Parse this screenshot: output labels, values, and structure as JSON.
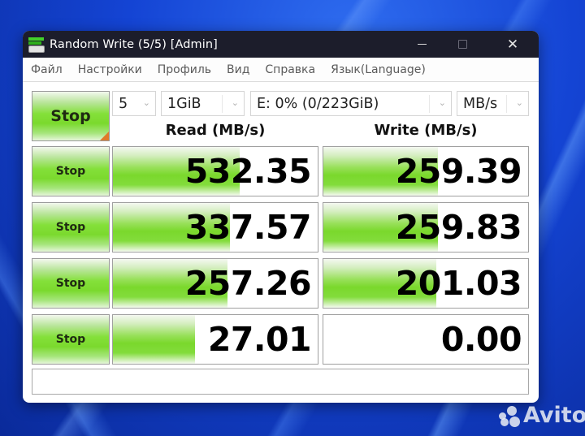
{
  "window": {
    "title": "Random Write (5/5) [Admin]",
    "controls": {
      "minimize": "—",
      "maximize": "□",
      "close": "✕"
    }
  },
  "menu": {
    "items": [
      "Файл",
      "Настройки",
      "Профиль",
      "Вид",
      "Справка",
      "Язык(Language)"
    ]
  },
  "toolbar": {
    "all_button_label": "Stop",
    "count": {
      "value": "5",
      "chevron": "⌄"
    },
    "size": {
      "value": "1GiB",
      "chevron": "⌄"
    },
    "drive": {
      "value": "E: 0% (0/223GiB)",
      "chevron": "⌄"
    },
    "unit": {
      "value": "MB/s",
      "chevron": "⌄"
    }
  },
  "headers": {
    "read": "Read (MB/s)",
    "write": "Write (MB/s)"
  },
  "rows": [
    {
      "button": "Stop",
      "read": "532.35",
      "read_fill": 0.62,
      "write": "259.39",
      "write_fill": 0.56
    },
    {
      "button": "Stop",
      "read": "337.57",
      "read_fill": 0.57,
      "write": "259.83",
      "write_fill": 0.56
    },
    {
      "button": "Stop",
      "read": "257.26",
      "read_fill": 0.56,
      "write": "201.03",
      "write_fill": 0.55
    },
    {
      "button": "Stop",
      "read": "27.01",
      "read_fill": 0.4,
      "write": "0.00",
      "write_fill": 0.0
    }
  ],
  "status_text": "",
  "watermark": {
    "text": "Avito"
  },
  "colors": {
    "titlebar": "#1c1d2b",
    "bar_green": "#7ad82c",
    "corner_accent": "#e07a2a"
  }
}
